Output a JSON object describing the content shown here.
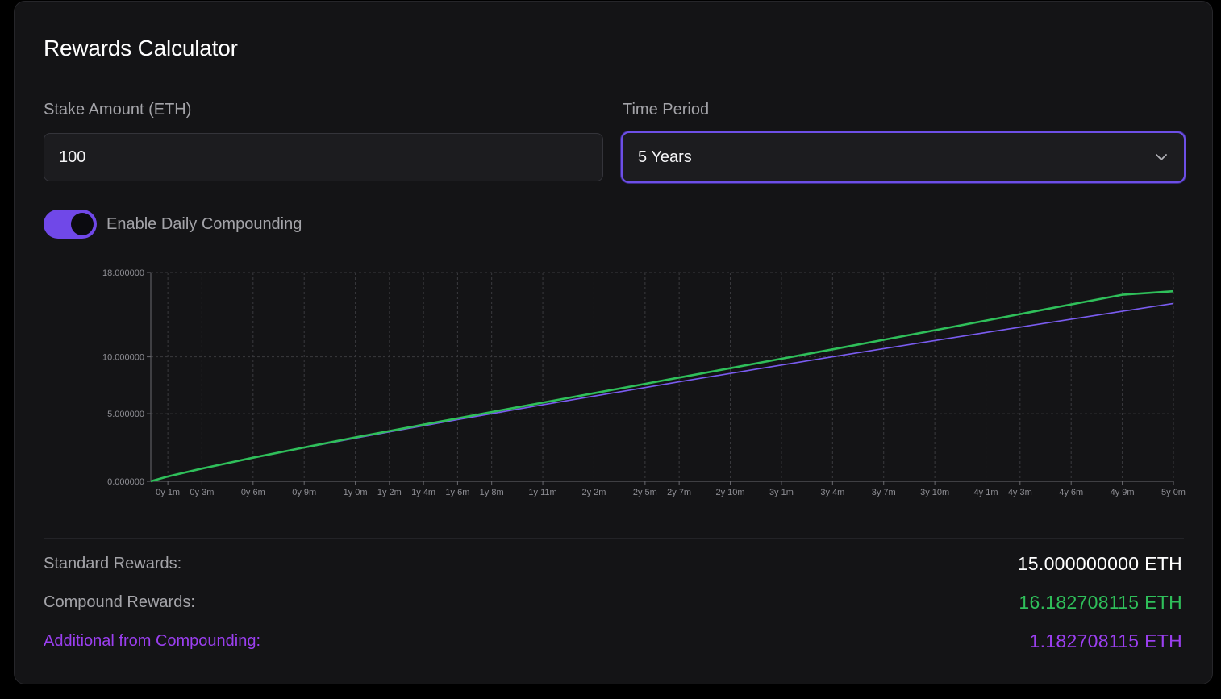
{
  "title": "Rewards Calculator",
  "stake": {
    "label": "Stake Amount (ETH)",
    "value": "100"
  },
  "period": {
    "label": "Time Period",
    "selected": "5 Years"
  },
  "compounding": {
    "label": "Enable Daily Compounding",
    "enabled": true
  },
  "colors": {
    "accent": "#7048e8",
    "compound_line": "#2fbf5a",
    "standard_line": "#7a5cf0",
    "highlight_purple": "#9b3ff0"
  },
  "chart_data": {
    "type": "line",
    "ylim": [
      0,
      18
    ],
    "y_ticks": [
      "0.000000",
      "5.000000",
      "10.000000",
      "18.000000"
    ],
    "x_ticks": [
      "0y 1m",
      "0y 3m",
      "0y 6m",
      "0y 9m",
      "1y 0m",
      "1y 2m",
      "1y 4m",
      "1y 6m",
      "1y 8m",
      "1y 11m",
      "2y 2m",
      "2y 5m",
      "2y 7m",
      "2y 10m",
      "3y 1m",
      "3y 4m",
      "3y 7m",
      "3y 10m",
      "4y 1m",
      "4y 3m",
      "4y 6m",
      "4y 9m",
      "5y 0m"
    ],
    "x_months": [
      1,
      3,
      6,
      9,
      12,
      14,
      16,
      18,
      20,
      23,
      26,
      29,
      31,
      34,
      37,
      40,
      43,
      46,
      49,
      51,
      54,
      57,
      60
    ],
    "grid": true,
    "series": [
      {
        "values": [
          0,
          0.25,
          0.75,
          1.5,
          2.25,
          3.0,
          3.5,
          4.0,
          4.5,
          5.0,
          5.75,
          6.5,
          7.25,
          7.75,
          8.5,
          9.25,
          10.0,
          10.75,
          11.5,
          12.25,
          12.75,
          13.5,
          14.25,
          15.0
        ],
        "color": "#7a5cf0"
      },
      {
        "values": [
          0,
          0.25,
          0.75,
          1.51,
          2.28,
          3.06,
          3.57,
          4.09,
          4.61,
          5.14,
          5.94,
          6.75,
          7.57,
          8.13,
          8.97,
          9.82,
          10.69,
          11.57,
          12.46,
          13.37,
          13.98,
          14.91,
          15.84,
          16.18
        ],
        "color": "#2fbf5a"
      }
    ]
  },
  "results": {
    "standard_label": "Standard Rewards:",
    "standard_value": "15.000000000 ETH",
    "compound_label": "Compound Rewards:",
    "compound_value": "16.182708115 ETH",
    "additional_label": "Additional from Compounding:",
    "additional_value": "1.182708115 ETH"
  }
}
